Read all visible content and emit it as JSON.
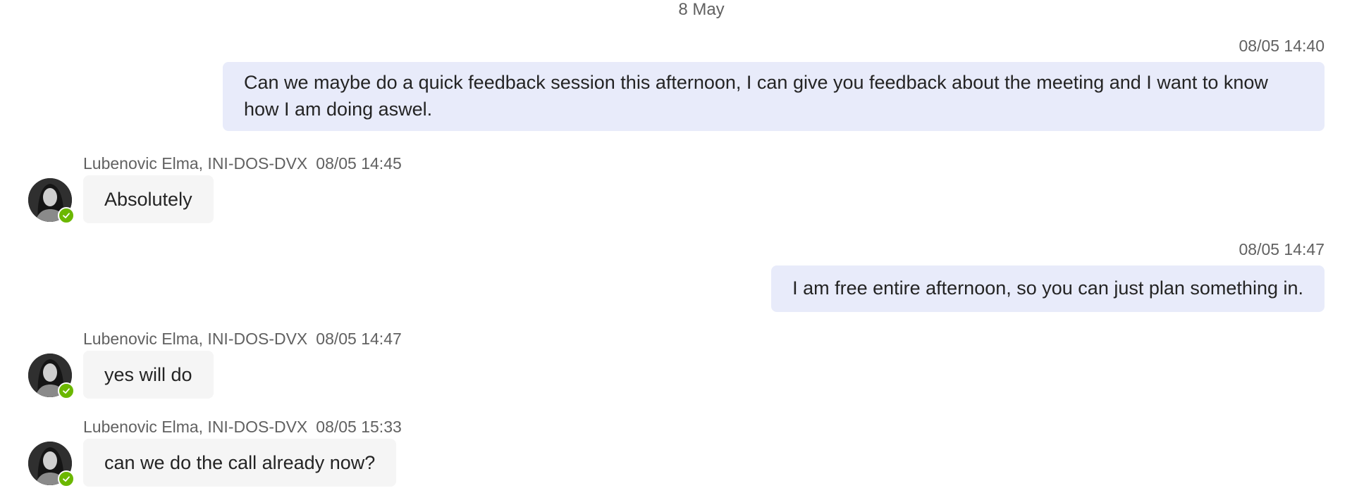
{
  "chat": {
    "date_divider": "8 May",
    "messages": [
      {
        "direction": "outgoing",
        "timestamp": "08/05 14:40",
        "text": "Can we maybe do a quick feedback session this afternoon, I can give you feedback about the meeting and I want to know how I am doing aswel."
      },
      {
        "direction": "incoming",
        "sender": "Lubenovic Elma, INI-DOS-DVX",
        "timestamp": "08/05 14:45",
        "text": "Absolutely",
        "presence": "available"
      },
      {
        "direction": "outgoing",
        "timestamp": "08/05 14:47",
        "text": "I am free entire afternoon, so you can just plan something in."
      },
      {
        "direction": "incoming",
        "sender": "Lubenovic Elma, INI-DOS-DVX",
        "timestamp": "08/05 14:47",
        "text": "yes will do",
        "presence": "available"
      },
      {
        "direction": "incoming",
        "sender": "Lubenovic Elma, INI-DOS-DVX",
        "timestamp": "08/05 15:33",
        "text": "can we do the call already now?",
        "presence": "available"
      }
    ]
  },
  "colors": {
    "outgoing_bubble": "#e8ebfa",
    "incoming_bubble": "#f5f5f5",
    "meta_text": "#616161",
    "presence_available": "#6bb700"
  },
  "icons": {
    "avatar": "user-photo",
    "presence": "check-icon"
  }
}
